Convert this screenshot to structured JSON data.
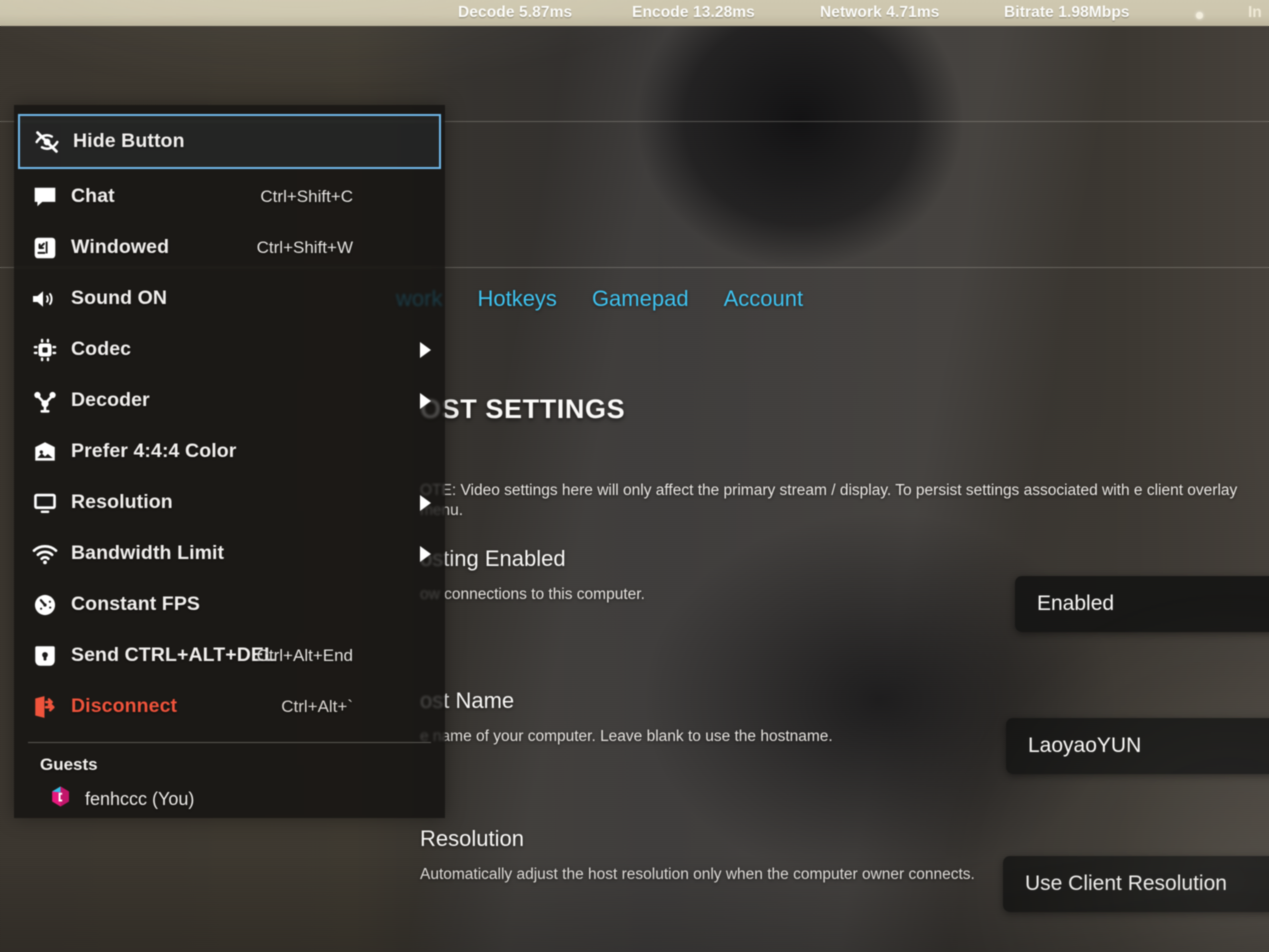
{
  "top_bar": {
    "stats": [
      {
        "label": "Decode",
        "value": "5.87ms"
      },
      {
        "label": "Encode",
        "value": "13.28ms"
      },
      {
        "label": "Network",
        "value": "4.71ms"
      },
      {
        "label": "Bitrate",
        "value": "1.98Mbps"
      }
    ],
    "indicator_dot": "status-dot",
    "truncated_text": "In"
  },
  "overlay_menu": {
    "items": [
      {
        "label": "Hide Button",
        "icon": "eye-slash-icon",
        "accel": "",
        "submenu": false,
        "selected": true,
        "danger": false
      },
      {
        "label": "Chat",
        "icon": "chat-bubble-icon",
        "accel": "Ctrl+Shift+C",
        "submenu": false,
        "selected": false,
        "danger": false
      },
      {
        "label": "Windowed",
        "icon": "windowed-icon",
        "accel": "Ctrl+Shift+W",
        "submenu": false,
        "selected": false,
        "danger": false
      },
      {
        "label": "Sound ON",
        "icon": "speaker-on-icon",
        "accel": "",
        "submenu": false,
        "selected": false,
        "danger": false
      },
      {
        "label": "Codec",
        "icon": "chip-icon",
        "accel": "",
        "submenu": true,
        "selected": false,
        "danger": false
      },
      {
        "label": "Decoder",
        "icon": "decoder-icon",
        "accel": "",
        "submenu": true,
        "selected": false,
        "danger": false
      },
      {
        "label": "Prefer 4:4:4 Color",
        "icon": "image-icon",
        "accel": "",
        "submenu": false,
        "selected": false,
        "danger": false
      },
      {
        "label": "Resolution",
        "icon": "monitor-icon",
        "accel": "",
        "submenu": true,
        "selected": false,
        "danger": false
      },
      {
        "label": "Bandwidth Limit",
        "icon": "wifi-icon",
        "accel": "",
        "submenu": true,
        "selected": false,
        "danger": false
      },
      {
        "label": "Constant FPS",
        "icon": "speedometer-icon",
        "accel": "",
        "submenu": false,
        "selected": false,
        "danger": false
      },
      {
        "label": "Send CTRL+ALT+DEL",
        "icon": "lock-icon",
        "accel": "Ctrl+Alt+End",
        "submenu": false,
        "selected": false,
        "danger": false
      },
      {
        "label": "Disconnect",
        "icon": "logout-icon",
        "accel": "Ctrl+Alt+`",
        "submenu": false,
        "selected": false,
        "danger": true
      }
    ],
    "guests_title": "Guests",
    "guests": [
      {
        "label": "fenhccc (You)",
        "icon": "parsec-avatar-icon"
      }
    ],
    "selection_color": "#6fb7e8",
    "danger_color": "#f0543c"
  },
  "settings_panel": {
    "tabs": [
      {
        "label": "work",
        "clipped": true
      },
      {
        "label": "Hotkeys",
        "clipped": false
      },
      {
        "label": "Gamepad",
        "clipped": false
      },
      {
        "label": "Account",
        "clipped": false
      }
    ],
    "tab_color": "#3fc3f0",
    "section_title": "OST SETTINGS",
    "note": "OTE: Video settings here will only affect the primary stream / display. To persist settings associated with e client overlay menu.",
    "rows": [
      {
        "name": "osting Enabled",
        "desc": "ow connections to this computer.",
        "control_value": "Enabled"
      },
      {
        "name": "ost Name",
        "desc": "e name of your computer. Leave blank to use the hostname.",
        "control_value": "LaoyaoYUN"
      },
      {
        "name": "Resolution",
        "desc": "Automatically adjust the host resolution only when the computer owner connects.",
        "control_value": "Use Client Resolution"
      }
    ]
  }
}
